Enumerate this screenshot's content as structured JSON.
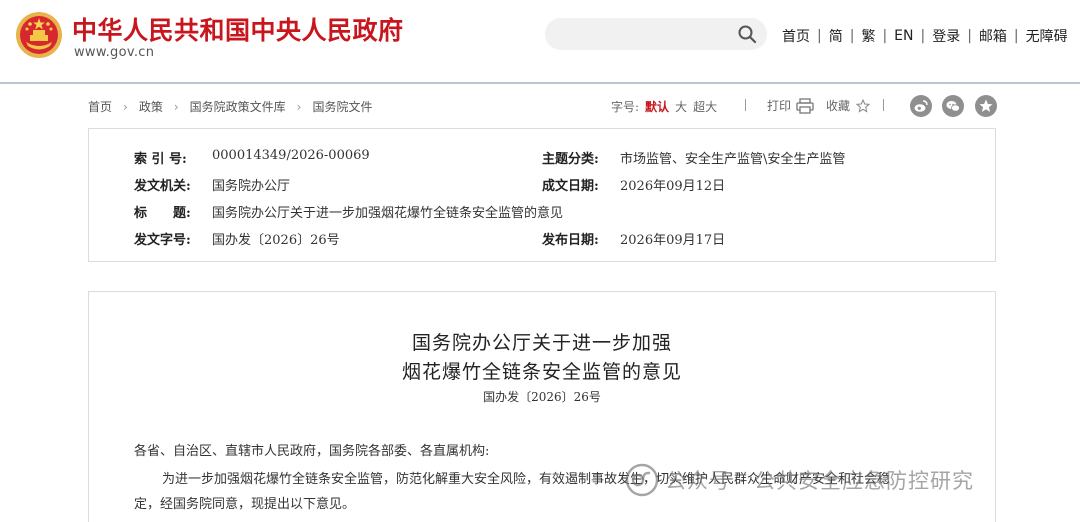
{
  "header": {
    "site_title": "中华人民共和国中央人民政府",
    "site_url": "www.gov.cn",
    "search": {
      "placeholder": ""
    },
    "nav": {
      "home": "首页",
      "simplified": "简",
      "traditional": "繁",
      "english": "EN",
      "login": "登录",
      "mail": "邮箱",
      "accessibility": "无障碍",
      "separator": "|"
    }
  },
  "breadcrumb": [
    "首页",
    "政策",
    "国务院政策文件库",
    "国务院文件"
  ],
  "breadcrumb_arrow": "›",
  "toolbar": {
    "font_size_label": "字号:",
    "font_default": "默认",
    "font_large": "大",
    "font_xlarge": "超大",
    "print_label": "打印",
    "favorite_label": "收藏"
  },
  "share_icons": [
    "weibo-icon",
    "wechat-icon",
    "qzone-icon"
  ],
  "meta": {
    "index_label": "索 引 号:",
    "index_value": "000014349/2026-00069",
    "category_label": "主题分类:",
    "category_value": "市场监管、安全生产监管\\安全生产监管",
    "issuer_label": "发文机关:",
    "issuer_value": "国务院办公厅",
    "created_label": "成文日期:",
    "created_value": "2026年09月12日",
    "title_label": "标　　题:",
    "title_value": "国务院办公厅关于进一步加强烟花爆竹全链条安全监管的意见",
    "docno_label": "发文字号:",
    "docno_value": "国办发〔2026〕26号",
    "published_label": "发布日期:",
    "published_value": "2026年09月17日"
  },
  "article": {
    "title_line1": "国务院办公厅关于进一步加强",
    "title_line2": "烟花爆竹全链条安全监管的意见",
    "doc_number": "国办发〔2026〕26号",
    "salutation": "各省、自治区、直辖市人民政府，国务院各部委、各直属机构:",
    "para1_line1": "为进一步加强烟花爆竹全链条安全监管，防范化解重大安全风险，有效遏制事故发生，切实维护人民群众生命财产安全和社会稳",
    "para1_line2": "定，经国务院同意，现提出以下意见。"
  },
  "watermark": {
    "text": "公众号 · 公共安全应急防控研究",
    "icon": "wechat-official-icon"
  },
  "colors": {
    "brand_red": "#c8161d",
    "header_rule": "#b8c6d8",
    "border": "#dcdcdc",
    "share_gray": "#8f8f8f"
  }
}
